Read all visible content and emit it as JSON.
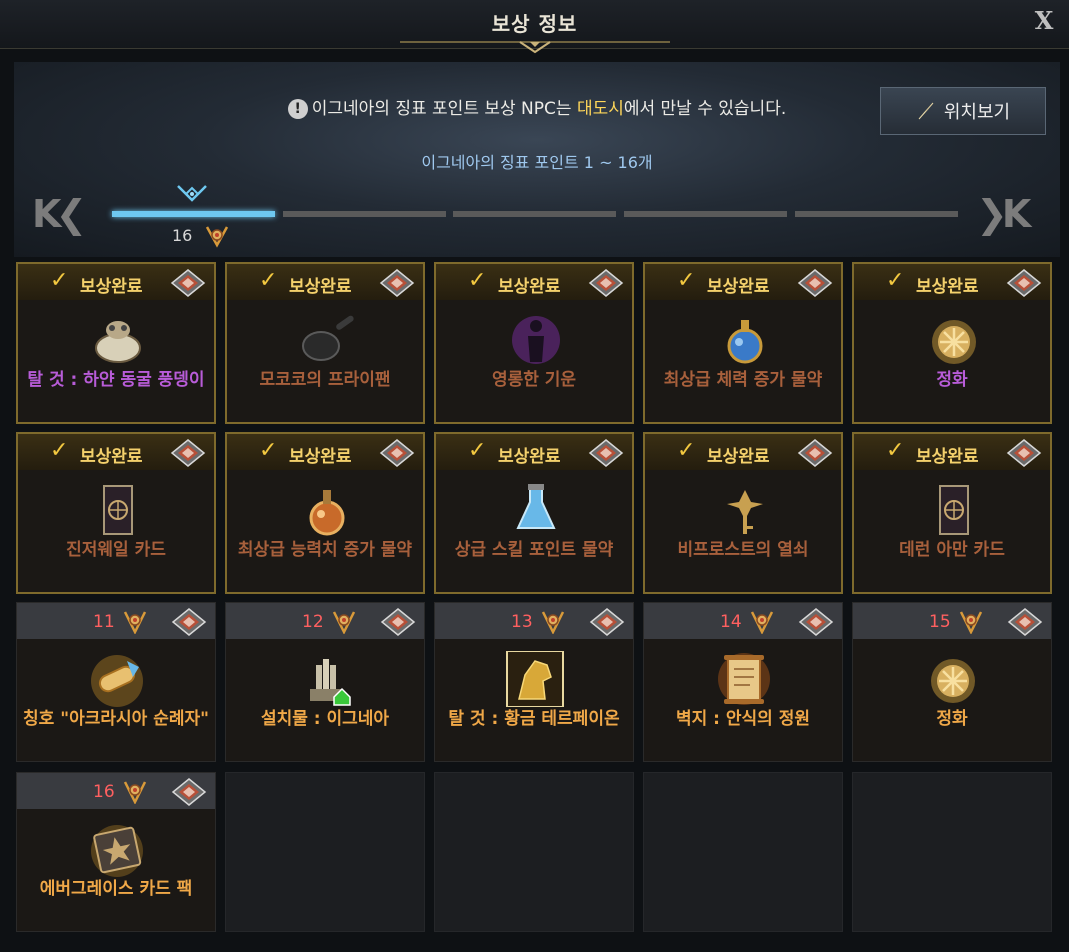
{
  "window": {
    "title": "보상 정보",
    "close_label": "X"
  },
  "banner": {
    "notice_icon": "!",
    "notice_pre": "이그네아의 징표 포인트 보상 NPC는 ",
    "notice_highlight": "대도시",
    "notice_post": "에서 만날 수 있습니다.",
    "location_button": "위치보기",
    "range_text": "이그네아의 징표 포인트 1 ~ 16개",
    "nav_first": "K❮",
    "nav_last": "❯K",
    "progress_value": "16",
    "segments_total": 5,
    "active_segment": 1
  },
  "colors": {
    "accent_blue": "#6ec8f0",
    "complete_gold": "#f4d16c",
    "slot_number_red": "#ff6060"
  },
  "rewards": [
    {
      "status": "보상완료",
      "name": "탈 것 : 하얀 동굴 풍뎅이",
      "icon": "mount-beetle-icon",
      "color": "purple"
    },
    {
      "status": "보상완료",
      "name": "모코코의 프라이팬",
      "icon": "frying-pan-icon",
      "color": "dull"
    },
    {
      "status": "보상완료",
      "name": "영롱한 기운",
      "icon": "aura-figure-icon",
      "color": "dull"
    },
    {
      "status": "보상완료",
      "name": "최상급 체력 증가 물약",
      "icon": "potion-blue-icon",
      "color": "dull"
    },
    {
      "status": "보상완료",
      "name": "정화",
      "icon": "purify-icon",
      "color": "purple"
    },
    {
      "status": "보상완료",
      "name": "진저웨일 카드",
      "icon": "card-icon",
      "color": "dull"
    },
    {
      "status": "보상완료",
      "name": "최상급 능력치 증가 물약",
      "icon": "potion-orange-icon",
      "color": "dull"
    },
    {
      "status": "보상완료",
      "name": "상급 스킬 포인트 물약",
      "icon": "potion-flask-icon",
      "color": "dull"
    },
    {
      "status": "보상완료",
      "name": "비프로스트의 열쇠",
      "icon": "key-icon",
      "color": "dull"
    },
    {
      "status": "보상완료",
      "name": "데런 아만 카드",
      "icon": "card-icon",
      "color": "dull"
    },
    {
      "number": "11",
      "name": "칭호 \"아크라시아 순례자\"",
      "icon": "title-scroll-icon",
      "color": "gold"
    },
    {
      "number": "12",
      "name": "설치물 : 이그네아",
      "icon": "statue-icon",
      "color": "gold"
    },
    {
      "number": "13",
      "name": "탈 것 : 황금 테르페이온",
      "icon": "golden-horse-icon",
      "color": "gold"
    },
    {
      "number": "14",
      "name": "벽지 : 안식의 정원",
      "icon": "wallpaper-scroll-icon",
      "color": "gold"
    },
    {
      "number": "15",
      "name": "정화",
      "icon": "purify-icon",
      "color": "gold"
    },
    {
      "number": "16",
      "name": "에버그레이스 카드 팩",
      "icon": "card-pack-icon",
      "color": "gold"
    }
  ]
}
